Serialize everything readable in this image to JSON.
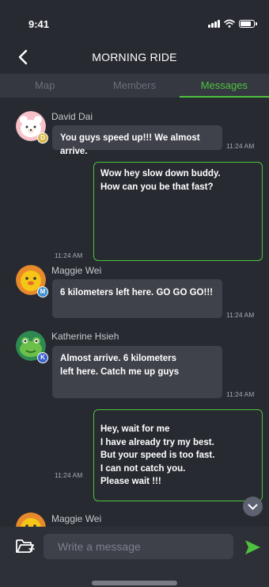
{
  "status_bar": {
    "time": "9:41",
    "battery_level": 0.85
  },
  "header": {
    "title": "MORNING RIDE",
    "back_icon": "chevron-left-icon"
  },
  "tabs": [
    {
      "label": "Map",
      "active": false
    },
    {
      "label": "Members",
      "active": false
    },
    {
      "label": "Messages",
      "active": true
    }
  ],
  "messages": [
    {
      "direction": "in",
      "sender": "David Dai",
      "badge": "D",
      "avatar": "bear-avatar",
      "text": "You guys speed up!!! We almost arrive.",
      "time": "11:24 AM"
    },
    {
      "direction": "out",
      "lines": [
        "Wow hey slow down buddy.",
        "How can you be that fast?"
      ],
      "time": "11:24 AM"
    },
    {
      "direction": "in",
      "sender": "Maggie Wei",
      "badge": "M",
      "avatar": "chick-avatar",
      "text": "6 kilometers left here. GO GO GO!!!",
      "time": "11:24 AM"
    },
    {
      "direction": "in",
      "sender": "Katherine Hsieh",
      "badge": "K",
      "avatar": "frog-avatar",
      "lines": [
        "Almost arrive. 6 kilometers",
        "left here. Catch me up guys"
      ],
      "time": "11:24 AM"
    },
    {
      "direction": "out",
      "lines": [
        "Hey, wait for me",
        "I have already try my best.",
        "But your speed is too fast.",
        "I can not catch you.",
        "Please wait !!!"
      ],
      "time": "11:24 AM"
    },
    {
      "direction": "in",
      "sender": "Maggie Wei",
      "badge": "M",
      "avatar": "chick-avatar"
    }
  ],
  "composer": {
    "placeholder": "Write a message",
    "attach_icon": "folder-icon",
    "send_icon": "send-icon",
    "scroll_icon": "chevron-down-icon"
  },
  "colors": {
    "accent": "#4ec23e",
    "background": "#272a31",
    "bubble_in": "#3f424b",
    "tab_bar": "#353841"
  }
}
